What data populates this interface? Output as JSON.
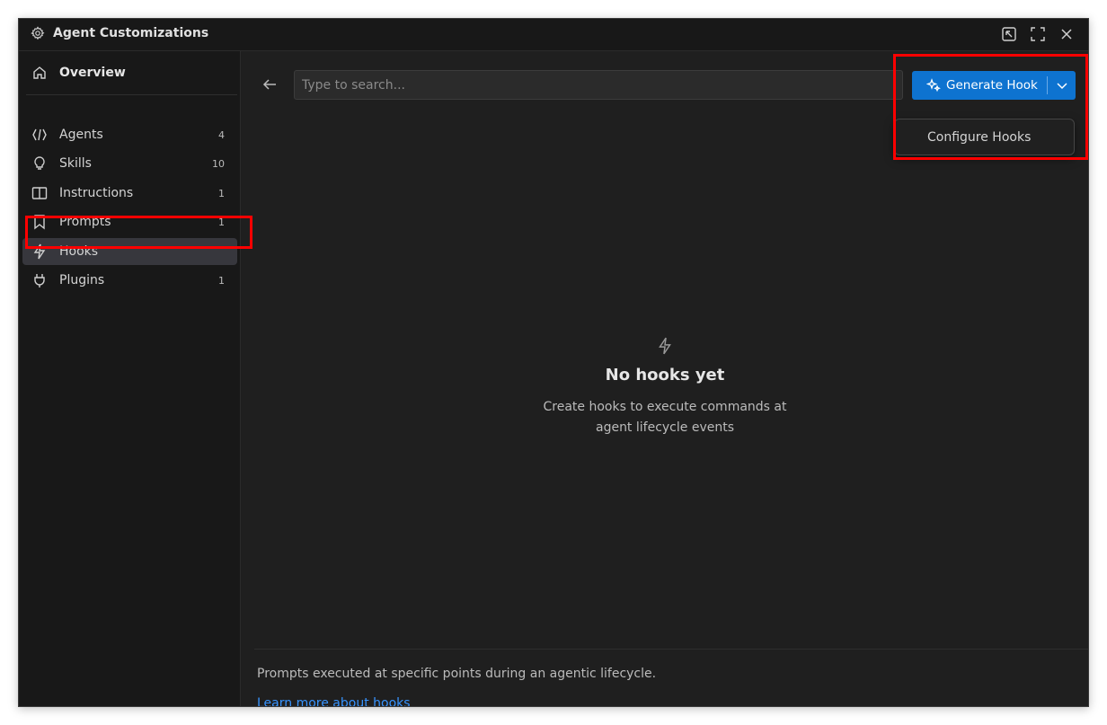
{
  "window": {
    "title": "Agent Customizations",
    "icons": [
      "settings-gear-icon",
      "layout-switch-icon",
      "maximize-icon",
      "close-icon"
    ]
  },
  "sidebar": {
    "overview": {
      "label": "Overview",
      "icon": "home-icon"
    },
    "items": [
      {
        "label": "Agents",
        "count": "4",
        "icon": "agent-icon"
      },
      {
        "label": "Skills",
        "count": "10",
        "icon": "lightbulb-icon"
      },
      {
        "label": "Instructions",
        "count": "1",
        "icon": "book-icon"
      },
      {
        "label": "Prompts",
        "count": "1",
        "icon": "bookmark-icon"
      },
      {
        "label": "Hooks",
        "count": "",
        "icon": "lightning-icon",
        "active": true
      },
      {
        "label": "Plugins",
        "count": "1",
        "icon": "plug-icon"
      }
    ]
  },
  "toolbar": {
    "search_placeholder": "Type to search...",
    "generate_label": "Generate Hook"
  },
  "dropdown": {
    "items": [
      "Configure Hooks"
    ]
  },
  "empty_state": {
    "title": "No hooks yet",
    "line1": "Create hooks to execute commands at",
    "line2": "agent lifecycle events"
  },
  "footer": {
    "description": "Prompts executed at specific points during an agentic lifecycle.",
    "link": "Learn more about hooks"
  },
  "colors": {
    "accent": "#0e73d0",
    "link": "#3794ff",
    "highlight": "#ff0000",
    "background": "#1f1f1f",
    "sidebar": "#181818"
  }
}
